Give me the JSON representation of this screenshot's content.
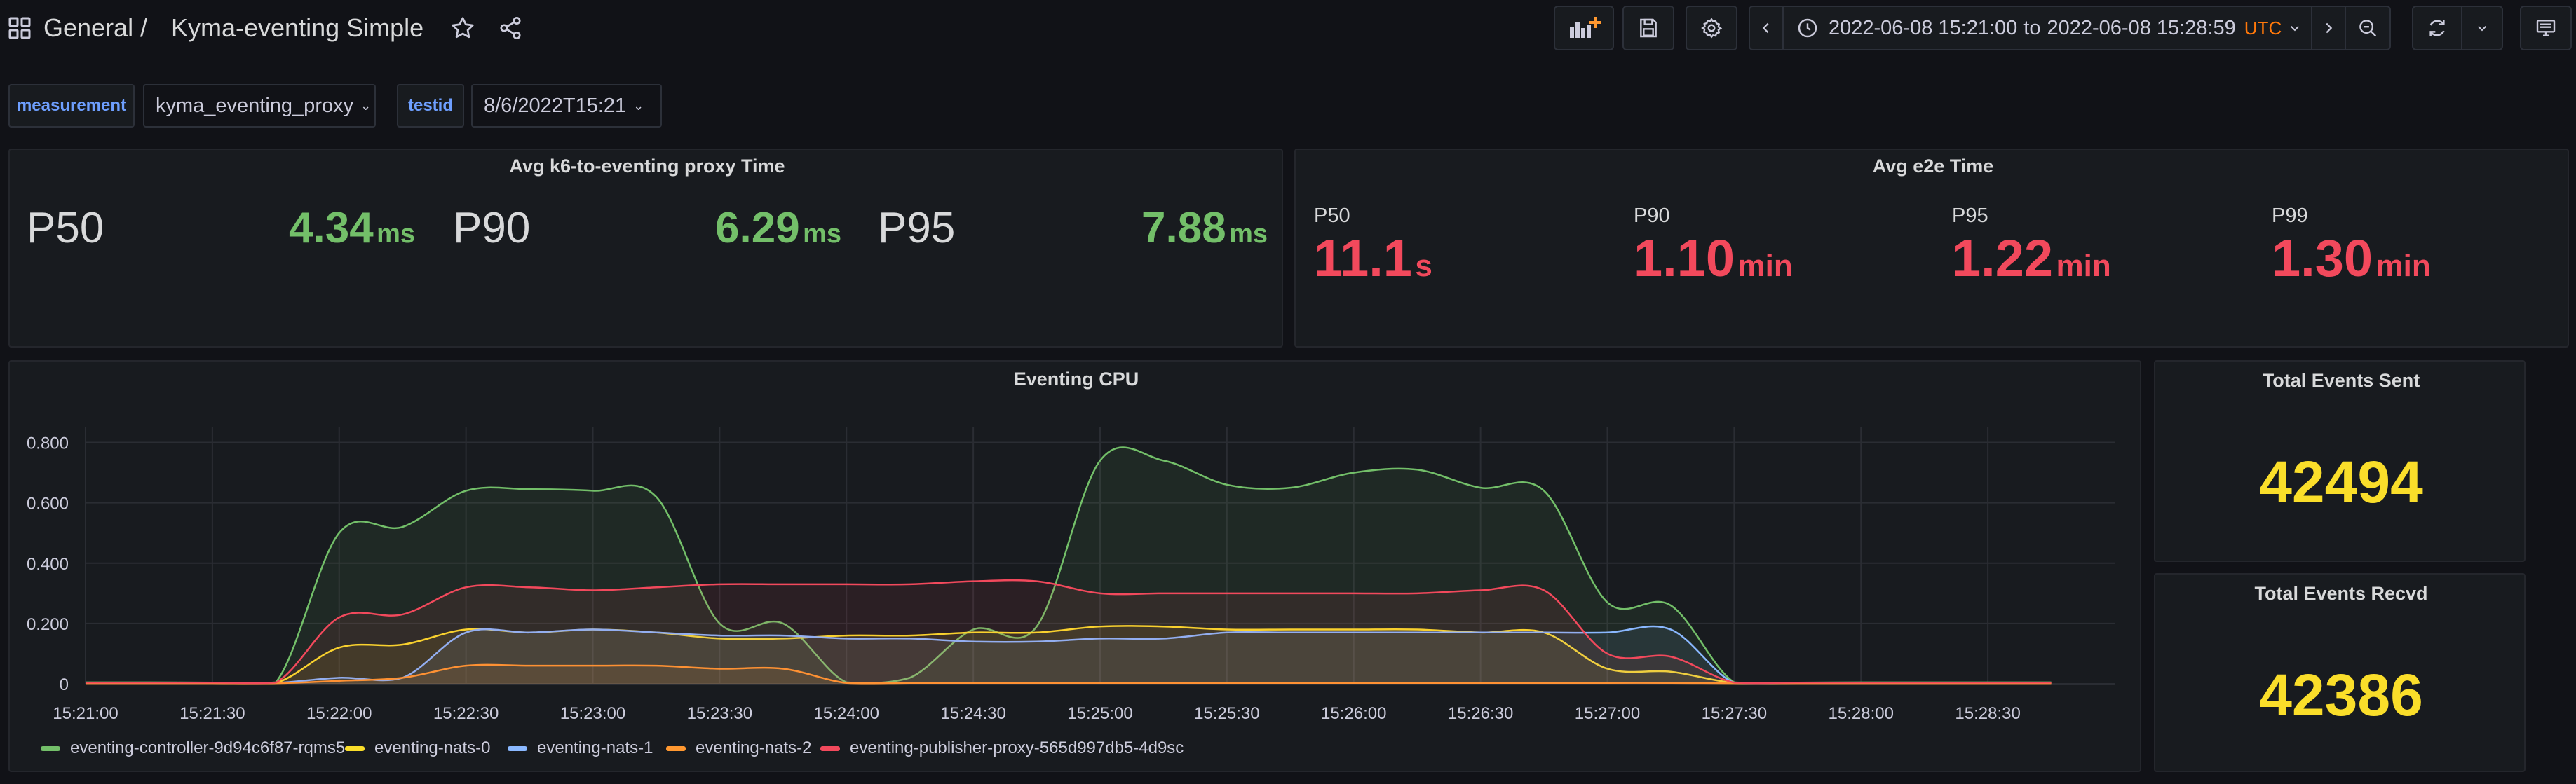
{
  "header": {
    "folder": "General",
    "separator": "/",
    "dashboard_title": "Kyma-eventing Simple",
    "time_from": "2022-06-08 15:21:00",
    "time_to_word": "to",
    "time_to": "2022-06-08 15:28:59",
    "timezone": "UTC"
  },
  "variables": [
    {
      "label": "measurement",
      "value": "kyma_eventing_proxy"
    },
    {
      "label": "testid",
      "value": "8/6/2022T15:21"
    }
  ],
  "panels": {
    "k6": {
      "title": "Avg k6-to-eventing proxy Time",
      "stats": [
        {
          "name": "P50",
          "value": "4.34",
          "unit": "ms"
        },
        {
          "name": "P90",
          "value": "6.29",
          "unit": "ms"
        },
        {
          "name": "P95",
          "value": "7.88",
          "unit": "ms"
        }
      ]
    },
    "e2e": {
      "title": "Avg e2e Time",
      "stats": [
        {
          "name": "P50",
          "value": "11.1",
          "unit": "s"
        },
        {
          "name": "P90",
          "value": "1.10",
          "unit": "min"
        },
        {
          "name": "P95",
          "value": "1.22",
          "unit": "min"
        },
        {
          "name": "P99",
          "value": "1.30",
          "unit": "min"
        }
      ]
    },
    "sent": {
      "title": "Total Events Sent",
      "value": "42494"
    },
    "recvd": {
      "title": "Total Events Recvd",
      "value": "42386"
    }
  },
  "colors": {
    "green": "#73bf69",
    "yellow": "#fade2a",
    "red": "#f2495c",
    "bg": "#111217",
    "panel": "#181b1f"
  },
  "chart_data": {
    "type": "area",
    "title": "Eventing CPU",
    "xlabel": "",
    "ylabel": "",
    "ylim": [
      0,
      0.85
    ],
    "xlim": [
      "15:21:00",
      "15:29:00"
    ],
    "y_ticks": [
      "0",
      "0.200",
      "0.400",
      "0.600",
      "0.800"
    ],
    "y_tick_values": [
      0,
      0.2,
      0.4,
      0.6,
      0.8
    ],
    "x_ticks": [
      "15:21:00",
      "15:21:30",
      "15:22:00",
      "15:22:30",
      "15:23:00",
      "15:23:30",
      "15:24:00",
      "15:24:30",
      "15:25:00",
      "15:25:30",
      "15:26:00",
      "15:26:30",
      "15:27:00",
      "15:27:30",
      "15:28:00",
      "15:28:30"
    ],
    "grid": true,
    "legend_position": "bottom-left",
    "x": [
      "15:21:00",
      "15:21:15",
      "15:21:30",
      "15:21:45",
      "15:22:00",
      "15:22:15",
      "15:22:30",
      "15:22:45",
      "15:23:00",
      "15:23:15",
      "15:23:30",
      "15:23:45",
      "15:24:00",
      "15:24:15",
      "15:24:30",
      "15:24:45",
      "15:25:00",
      "15:25:15",
      "15:25:30",
      "15:25:45",
      "15:26:00",
      "15:26:15",
      "15:26:30",
      "15:26:45",
      "15:27:00",
      "15:27:15",
      "15:27:30",
      "15:27:45",
      "15:28:00",
      "15:28:15",
      "15:28:30",
      "15:28:45"
    ],
    "series": [
      {
        "name": "eventing-controller-9d94c6f87-rqms5",
        "color": "#73bf69",
        "values": [
          0.005,
          0.005,
          0.004,
          0.005,
          0.5,
          0.52,
          0.64,
          0.645,
          0.64,
          0.62,
          0.2,
          0.2,
          0.005,
          0.02,
          0.18,
          0.19,
          0.74,
          0.74,
          0.66,
          0.65,
          0.7,
          0.71,
          0.65,
          0.64,
          0.27,
          0.26,
          0.005,
          0.004,
          0.005,
          0.005,
          0.005,
          0.005
        ]
      },
      {
        "name": "eventing-nats-0",
        "color": "#fade2a",
        "values": [
          0.003,
          0.003,
          0.003,
          0.003,
          0.12,
          0.13,
          0.18,
          0.17,
          0.18,
          0.17,
          0.15,
          0.15,
          0.16,
          0.16,
          0.17,
          0.17,
          0.19,
          0.19,
          0.18,
          0.18,
          0.18,
          0.18,
          0.17,
          0.17,
          0.05,
          0.04,
          0.003,
          0.003,
          0.003,
          0.003,
          0.003,
          0.003
        ]
      },
      {
        "name": "eventing-nats-1",
        "color": "#8ab8ff",
        "values": [
          0.003,
          0.003,
          0.003,
          0.003,
          0.02,
          0.02,
          0.17,
          0.17,
          0.18,
          0.17,
          0.16,
          0.16,
          0.15,
          0.15,
          0.14,
          0.14,
          0.15,
          0.15,
          0.17,
          0.17,
          0.17,
          0.17,
          0.17,
          0.17,
          0.17,
          0.18,
          0.003,
          0.003,
          0.003,
          0.003,
          0.003,
          0.003
        ]
      },
      {
        "name": "eventing-nats-2",
        "color": "#ff9830",
        "values": [
          0.002,
          0.002,
          0.002,
          0.002,
          0.01,
          0.02,
          0.06,
          0.06,
          0.06,
          0.06,
          0.05,
          0.05,
          0.003,
          0.003,
          0.003,
          0.003,
          0.003,
          0.003,
          0.003,
          0.003,
          0.003,
          0.003,
          0.003,
          0.003,
          0.003,
          0.003,
          0.002,
          0.002,
          0.002,
          0.002,
          0.002,
          0.002
        ]
      },
      {
        "name": "eventing-publisher-proxy-565d997db5-4d9sc",
        "color": "#f2495c",
        "values": [
          0.004,
          0.004,
          0.004,
          0.004,
          0.22,
          0.23,
          0.32,
          0.32,
          0.31,
          0.32,
          0.33,
          0.33,
          0.33,
          0.33,
          0.34,
          0.34,
          0.3,
          0.3,
          0.3,
          0.3,
          0.3,
          0.3,
          0.31,
          0.31,
          0.1,
          0.09,
          0.004,
          0.004,
          0.004,
          0.004,
          0.004,
          0.004
        ]
      }
    ]
  }
}
